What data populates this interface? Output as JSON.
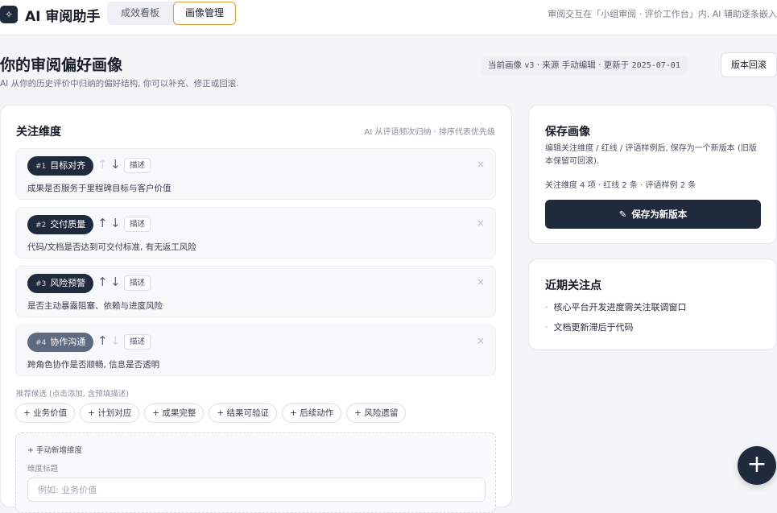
{
  "header": {
    "logo_icon": "✧",
    "app_title": "AI 审阅助手",
    "tabs": [
      {
        "label": "成效看板",
        "active": false
      },
      {
        "label": "画像管理",
        "active": true
      }
    ],
    "note": "审阅交互在「小组审阅 · 评价工作台」内, AI 辅助逐条嵌入"
  },
  "page": {
    "title": "你的审阅偏好画像",
    "subtitle": "AI 从你的历史评价中归纳的偏好结构, 你可以补充、修正或回滚.",
    "version_label": "当前画像",
    "version": "v3",
    "source_label": "来源",
    "source": "手动编辑",
    "updated_label": "更新于",
    "updated": "2025-07-01",
    "rollback_label": "版本回滚"
  },
  "dimensions_section": {
    "title": "关注维度",
    "hint": "AI 从评语频次归纳 · 排序代表优先级",
    "desc_button_label": "描述",
    "items": [
      {
        "num": "#1",
        "label": "目标对齐",
        "desc": "成果是否服务于里程碑目标与客户价值"
      },
      {
        "num": "#2",
        "label": "交付质量",
        "desc": "代码/文档是否达到可交付标准, 有无返工风险"
      },
      {
        "num": "#3",
        "label": "风险预警",
        "desc": "是否主动暴露阻塞、依赖与进度风险"
      },
      {
        "num": "#4",
        "label": "协作沟通",
        "desc": "跨角色协作是否顺畅, 信息是否透明"
      }
    ],
    "recommend_label": "推荐候选 (点击添加, 含预填描述)",
    "recommend_chips": [
      "+ 业务价值",
      "+ 计划对应",
      "+ 成果完整",
      "+ 结果可验证",
      "+ 后续动作",
      "+ 风险遗留"
    ],
    "manual_add": {
      "title": "+ 手动新增维度",
      "field_label": "维度标题",
      "placeholder": "例如: 业务价值"
    }
  },
  "save_card": {
    "title": "保存画像",
    "desc": "编辑关注维度 / 红线 / 评语样例后, 保存为一个新版本 (旧版本保留可回滚).",
    "stats": "关注维度 4 项 · 红线 2 条 · 评语样例 2 条",
    "button_label": "保存为新版本"
  },
  "focus_card": {
    "title": "近期关注点",
    "items": [
      "核心平台开发进度需关注联调窗口",
      "文档更新滞后于代码"
    ]
  },
  "icons": {
    "arrow_up": "↑",
    "arrow_down": "↓",
    "close": "×",
    "pen": "✎",
    "plus": "+"
  },
  "colors": {
    "primary": "#1f2a3c",
    "active_tab_border": "#d8a13a",
    "background": "#f4f5f7"
  }
}
